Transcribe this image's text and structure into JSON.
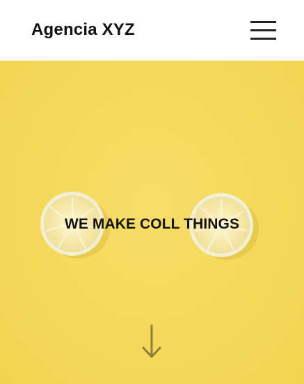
{
  "header": {
    "logo": "Agencia XYZ",
    "menu_icon": "hamburger-menu-icon"
  },
  "hero": {
    "title": "WE MAKE COLL THINGS",
    "background_color": "#f5d858",
    "decorations": [
      "lemon-slice-image",
      "lemon-slice-image"
    ],
    "scroll_icon": "arrow-down-icon"
  }
}
